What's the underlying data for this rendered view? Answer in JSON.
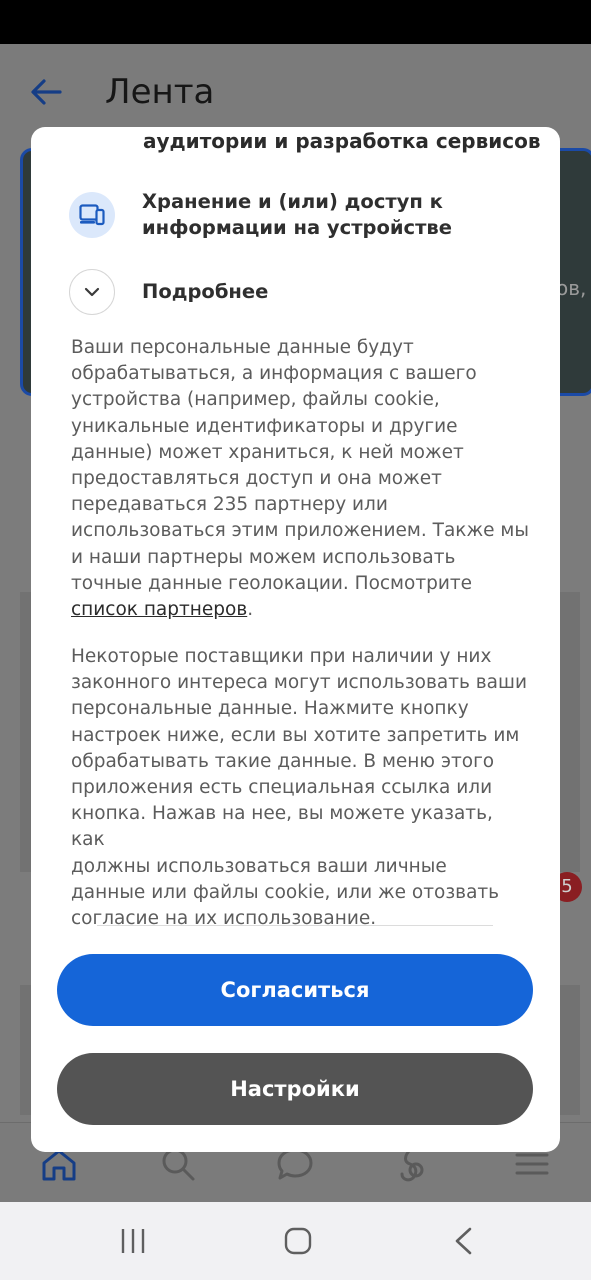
{
  "app_bar": {
    "title": "Лента"
  },
  "background": {
    "card_text_fragment": "ов,",
    "notification_badge": "5"
  },
  "dialog": {
    "clipped_heading": "аудитории и разработка сервисов",
    "purposes": [
      {
        "label_line1": "Хранение и (или) доступ к",
        "label_line2": "информации на устройстве",
        "icon": "device-storage-icon"
      },
      {
        "label_line1": "Подробнее",
        "icon": "chevron-down-icon"
      }
    ],
    "paragraph1_lines": [
      "Ваши персональные данные будут",
      "обрабатываться, а информация с вашего",
      "устройства (например, файлы cookie,",
      "уникальные идентификаторы и другие",
      "данные) может храниться, к ней может",
      "предоставляться доступ и она может",
      "передаваться 235 партнеру или",
      "использоваться этим приложением. Также мы",
      "и наши партнеры можем использовать",
      "точные данные геолокации. Посмотрите"
    ],
    "partners_link": "список партнеров",
    "partners_link_suffix": ".",
    "paragraph2_lines": [
      "Некоторые поставщики при наличии у них",
      "законного интереса могут использовать ваши",
      "персональные данные. Нажмите кнопку",
      "настроек ниже, если вы хотите запретить им",
      "обрабатывать такие данные. В меню этого",
      "приложения есть специальная ссылка или",
      "кнопка. Нажав на нее, вы можете указать, как",
      "должны использоваться ваши личные",
      "данные или файлы cookie, или же отозвать",
      "согласие на их использование."
    ],
    "agree_button": "Согласиться",
    "settings_button": "Настройки"
  },
  "colors": {
    "primary": "#1565d8",
    "secondary_button": "#545454",
    "scrim": "#7c7c7c",
    "icon_bg": "#dbe8fb"
  }
}
